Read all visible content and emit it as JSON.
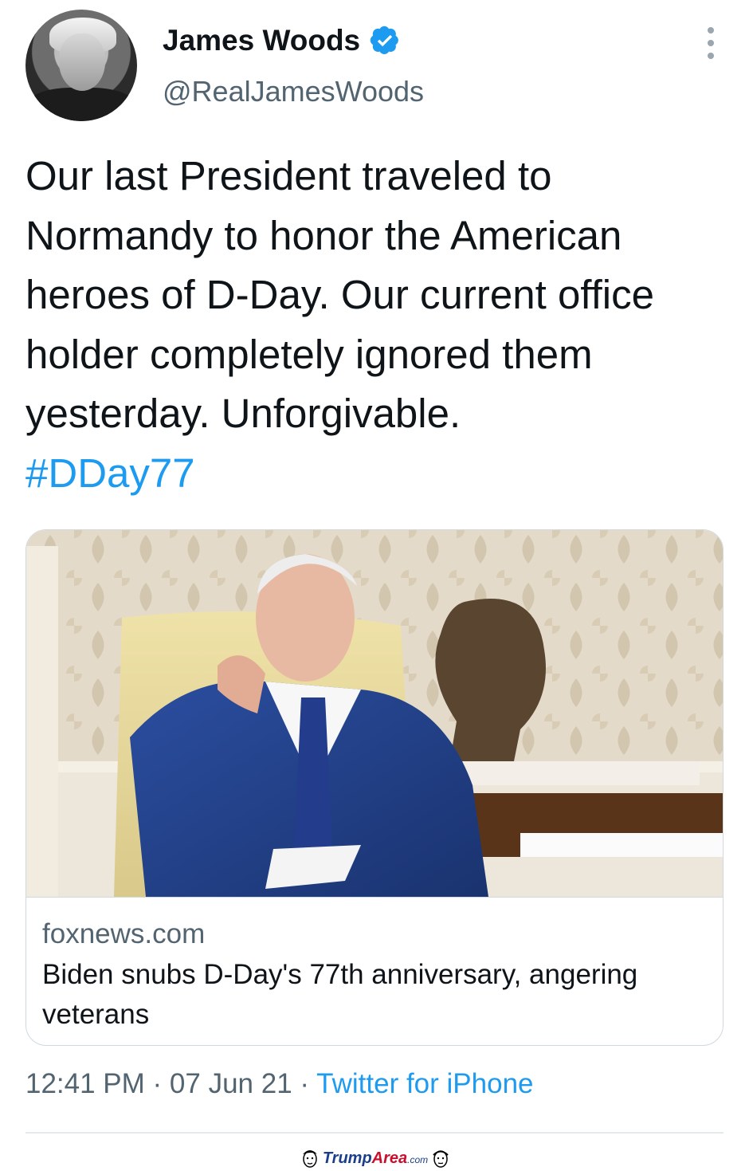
{
  "author": {
    "name": "James Woods",
    "handle": "@RealJamesWoods",
    "verified": true,
    "verified_color": "#1d9bf0"
  },
  "tweet": {
    "text": "Our last President traveled to Normandy to honor the American heroes of D-Day. Our current office holder completely ignored them yesterday. Unforgivable.",
    "hashtag": "#DDay77"
  },
  "link_card": {
    "image_icon": "news-photo",
    "domain": "foxnews.com",
    "title": "Biden snubs D-Day's 77th anniversary, angering veterans"
  },
  "meta": {
    "time": "12:41 PM",
    "separator": " · ",
    "date": "07 Jun 21",
    "source": "Twitter for iPhone"
  },
  "watermark": {
    "brand": "Trump",
    "brand_accent": "Area",
    "suffix": ".com"
  },
  "colors": {
    "text": "#0f1419",
    "secondary": "#536471",
    "link": "#1d9bf0",
    "border": "#cfd9de"
  }
}
